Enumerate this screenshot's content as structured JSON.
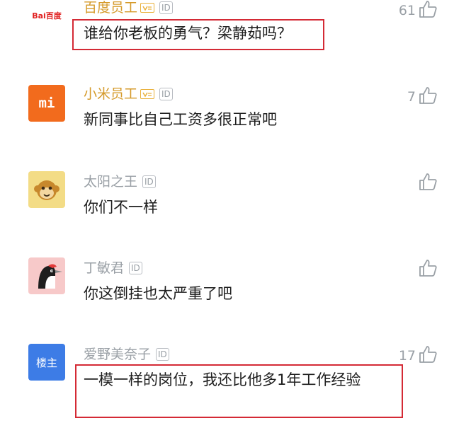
{
  "comments": [
    {
      "avatar_text": "Bai百度",
      "name": "百度员工",
      "id_tag": "ID",
      "text": "谁给你老板的勇气？梁静茹吗？",
      "likes": "61"
    },
    {
      "avatar_text": "mi",
      "name": "小米员工",
      "id_tag": "ID",
      "text": "新同事比自己工资多很正常吧",
      "likes": "7"
    },
    {
      "avatar_text": "",
      "name": "太阳之王",
      "id_tag": "ID",
      "text": "你们不一样",
      "likes": ""
    },
    {
      "avatar_text": "",
      "name": "丁敏君",
      "id_tag": "ID",
      "text": "你这倒挂也太严重了吧",
      "likes": ""
    },
    {
      "avatar_text": "楼主",
      "name": "爱野美奈子",
      "id_tag": "ID",
      "text": "一模一样的岗位，我还比他多1年工作经验",
      "likes": "17"
    }
  ],
  "colors": {
    "highlight": "#d42a35",
    "verified_name": "#d59a2a",
    "gray": "#9aa0a6",
    "xiaomi": "#f26b1d",
    "op_avatar": "#3d7ce6"
  }
}
